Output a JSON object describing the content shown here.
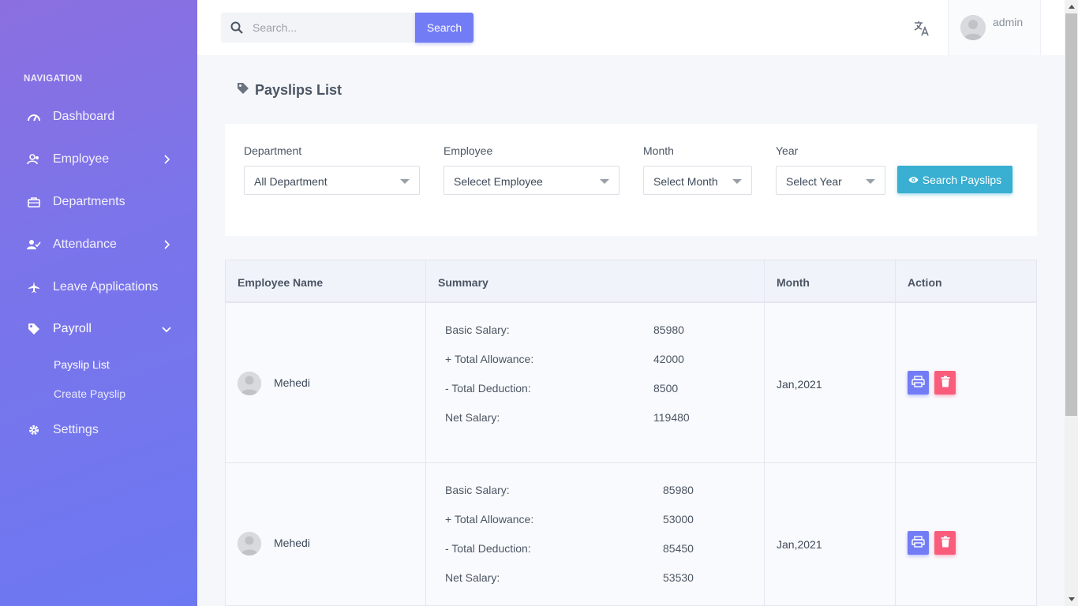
{
  "sidebar": {
    "heading": "NAVIGATION",
    "items": [
      {
        "label": "Dashboard",
        "icon": "speedometer-icon"
      },
      {
        "label": "Employee",
        "icon": "users-icon"
      },
      {
        "label": "Departments",
        "icon": "briefcase-icon"
      },
      {
        "label": "Attendance",
        "icon": "user-check-icon"
      },
      {
        "label": "Leave Applications",
        "icon": "airplane-icon"
      },
      {
        "label": "Payroll",
        "icon": "tag-icon"
      },
      {
        "label": "Settings",
        "icon": "gear-icon"
      }
    ],
    "payroll_sub": [
      "Payslip List",
      "Create Payslip"
    ],
    "gradient": [
      "#8b6fe0",
      "#6c78f2"
    ]
  },
  "topbar": {
    "search_placeholder": "Search...",
    "search_button": "Search",
    "user_name": "admin"
  },
  "page": {
    "title": "Payslips List"
  },
  "filters": {
    "department": {
      "label": "Department",
      "value": "All Department"
    },
    "employee": {
      "label": "Employee",
      "value": "Selecet Employee"
    },
    "month": {
      "label": "Month",
      "value": "Select Month"
    },
    "year": {
      "label": "Year",
      "value": "Select Year"
    },
    "search_button": "Search Payslips"
  },
  "table": {
    "headers": [
      "Employee Name",
      "Summary",
      "Month",
      "Action"
    ],
    "summary_labels": [
      "Basic Salary:",
      "+ Total Allowance:",
      "- Total Deduction:",
      "Net Salary:"
    ],
    "rows": [
      {
        "name": "Mehedi",
        "summary": [
          "85980",
          "42000",
          "8500",
          "119480"
        ],
        "month": "Jan,2021"
      },
      {
        "name": "Mehedi",
        "summary": [
          "85980",
          "53000",
          "85450",
          "53530"
        ],
        "month": "Jan,2021"
      }
    ]
  },
  "colors": {
    "primary": "#727cf5",
    "info": "#39afd1",
    "danger": "#fa5c7c"
  }
}
